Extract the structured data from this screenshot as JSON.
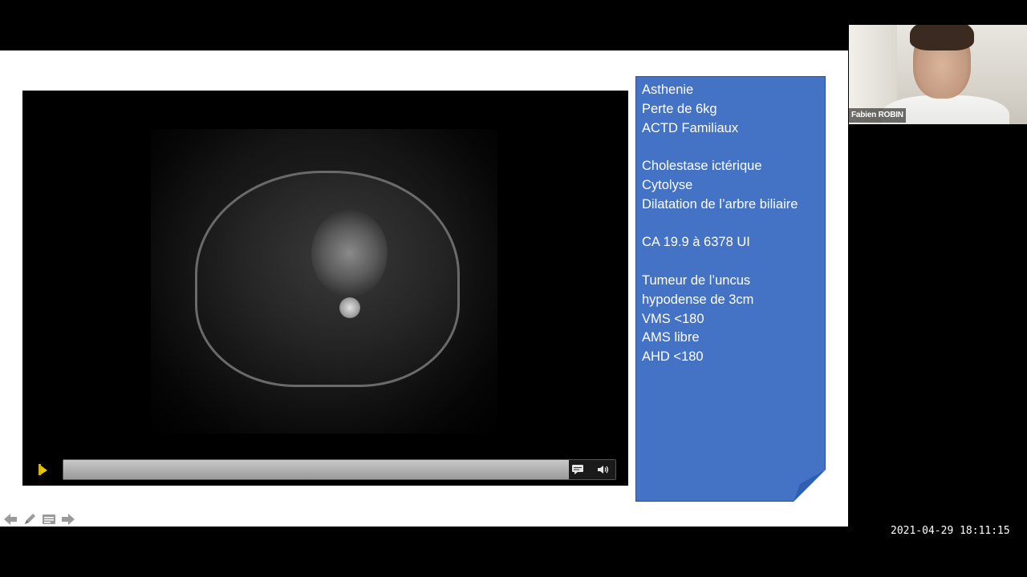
{
  "webcam": {
    "participant_name": "Fabien ROBIN"
  },
  "info_panel": {
    "lines": [
      "Asthenie",
      "Perte de 6kg",
      "ACTD Familiaux",
      "",
      "Cholestase ictérique",
      "Cytolyse",
      "Dilatation de l’arbre biliaire",
      "",
      "CA 19.9 à 6378 UI",
      "",
      "Tumeur de l’uncus",
      "hypodense de 3cm",
      "VMS <180",
      "AMS libre",
      "AHD <180"
    ],
    "background": "#4472c4"
  },
  "video_player": {
    "controls": {
      "play_icon": "play-icon",
      "captions_icon": "captions-icon",
      "volume_icon": "volume-icon"
    }
  },
  "slide_nav": {
    "icons": [
      "arrow-left-icon",
      "pen-icon",
      "menu-icon",
      "arrow-right-icon"
    ]
  },
  "recording": {
    "timestamp": "2021-04-29  18:11:15"
  }
}
